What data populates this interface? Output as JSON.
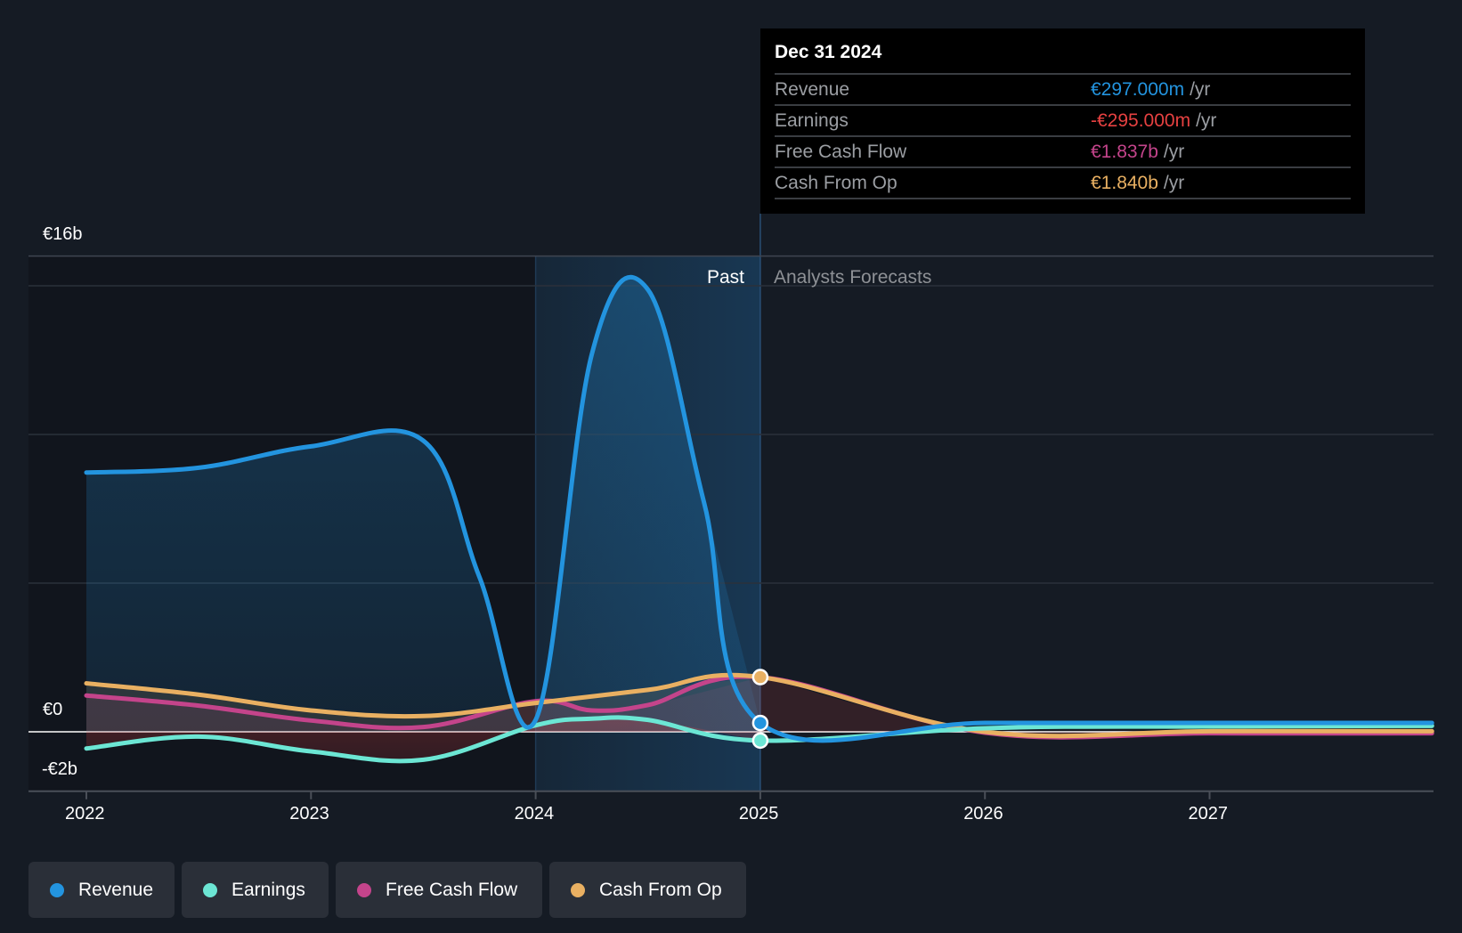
{
  "tooltip": {
    "date": "Dec 31 2024",
    "rows": [
      {
        "label": "Revenue",
        "value": "€297.000m",
        "unit": "/yr",
        "color": "#2394df"
      },
      {
        "label": "Earnings",
        "value": "-€295.000m",
        "unit": "/yr",
        "color": "#e64141"
      },
      {
        "label": "Free Cash Flow",
        "value": "€1.837b",
        "unit": "/yr",
        "color": "#c4448b"
      },
      {
        "label": "Cash From Op",
        "value": "€1.840b",
        "unit": "/yr",
        "color": "#e9b062"
      }
    ]
  },
  "regions": {
    "past": "Past",
    "forecast": "Analysts Forecasts"
  },
  "legend": [
    {
      "label": "Revenue",
      "color": "#2394df"
    },
    {
      "label": "Earnings",
      "color": "#6ce6d4"
    },
    {
      "label": "Free Cash Flow",
      "color": "#c4448b"
    },
    {
      "label": "Cash From Op",
      "color": "#e9b062"
    }
  ],
  "chart_data": {
    "type": "line",
    "title": "",
    "xlabel": "",
    "ylabel": "",
    "x_ticks": [
      "2022",
      "2023",
      "2024",
      "2025",
      "2026",
      "2027"
    ],
    "y_tick_labels": [
      "€16b",
      "€0",
      "-€2b"
    ],
    "y_ticks": [
      16,
      0,
      -2
    ],
    "ylim": [
      -2,
      16
    ],
    "xlim": [
      2021.75,
      2027.99
    ],
    "gridlines": [
      5,
      10,
      15
    ],
    "grid": true,
    "legend_position": "bottom-left",
    "units": "EUR billions",
    "past_forecast_split": 2025.0,
    "highlight_range": [
      2024.0,
      2025.0
    ],
    "series": [
      {
        "name": "Revenue",
        "color": "#2394df",
        "x": [
          2022.0,
          2022.5,
          2023.0,
          2023.5,
          2023.75,
          2024.0,
          2024.25,
          2024.5,
          2024.75,
          2025.0,
          2026.0,
          2027.0,
          2027.99
        ],
        "values": [
          8.72,
          8.88,
          9.6,
          9.79,
          5.2,
          0.4,
          12.7,
          14.87,
          7.7,
          0.297,
          0.3,
          0.3,
          0.3
        ]
      },
      {
        "name": "Earnings",
        "color": "#6ce6d4",
        "x": [
          2022.0,
          2022.5,
          2023.0,
          2023.5,
          2024.0,
          2024.25,
          2024.5,
          2025.0,
          2026.0,
          2027.0,
          2027.99
        ],
        "values": [
          -0.56,
          -0.16,
          -0.66,
          -0.94,
          0.22,
          0.44,
          0.4,
          -0.295,
          0.12,
          0.18,
          0.2
        ]
      },
      {
        "name": "Free Cash Flow",
        "color": "#c4448b",
        "x": [
          2022.0,
          2022.5,
          2023.0,
          2023.5,
          2024.0,
          2024.25,
          2024.5,
          2025.0,
          2026.0,
          2027.0,
          2027.99
        ],
        "values": [
          1.22,
          0.88,
          0.38,
          0.16,
          1.03,
          0.72,
          0.9,
          1.837,
          -0.03,
          -0.05,
          -0.05
        ]
      },
      {
        "name": "Cash From Op",
        "color": "#e9b062",
        "x": [
          2022.0,
          2022.5,
          2023.0,
          2023.5,
          2024.0,
          2024.5,
          2025.0,
          2026.0,
          2027.0,
          2027.99
        ],
        "values": [
          1.63,
          1.25,
          0.72,
          0.53,
          0.97,
          1.41,
          1.84,
          0.0,
          0.02,
          0.02
        ]
      }
    ]
  }
}
